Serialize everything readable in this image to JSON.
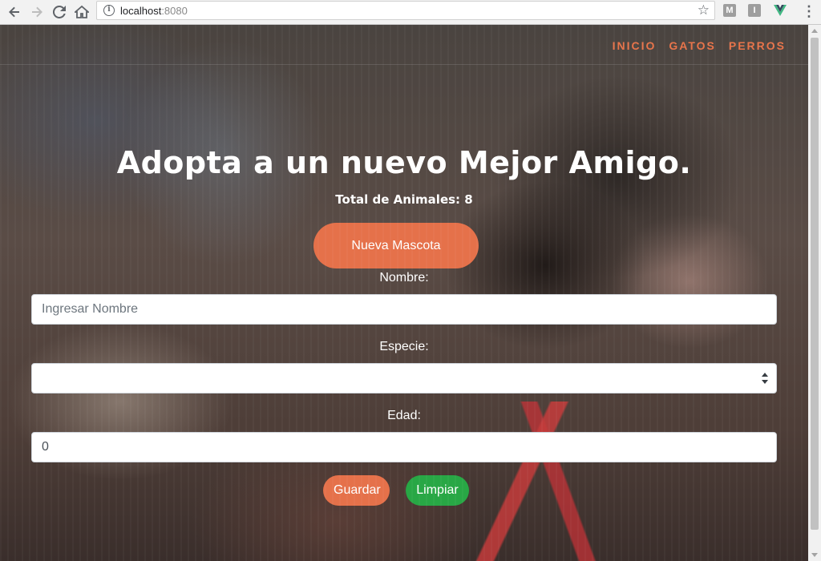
{
  "browser": {
    "url_host": "localhost",
    "url_port": ":8080",
    "extensions": [
      "M",
      "I",
      "V"
    ],
    "icons": {
      "back": "arrow-left-icon",
      "forward": "arrow-right-icon",
      "reload": "reload-icon",
      "home": "home-icon",
      "info": "info-icon",
      "bookmark": "star-icon",
      "menu": "kebab-menu-icon"
    }
  },
  "nav": {
    "items": [
      "INICIO",
      "GATOS",
      "PERROS"
    ]
  },
  "hero": {
    "title": "Adopta a un nuevo Mejor Amigo.",
    "subtitle": "Total de Animales: 8",
    "new_button": "Nueva Mascota"
  },
  "form": {
    "name_label": "Nombre:",
    "name_placeholder": "Ingresar Nombre",
    "name_value": "",
    "species_label": "Especie:",
    "species_value": "",
    "age_label": "Edad:",
    "age_value": "0",
    "save_button": "Guardar",
    "clear_button": "Limpiar"
  },
  "colors": {
    "accent": "#e5714a",
    "nav_link": "#e8744a",
    "success": "#28a745"
  }
}
